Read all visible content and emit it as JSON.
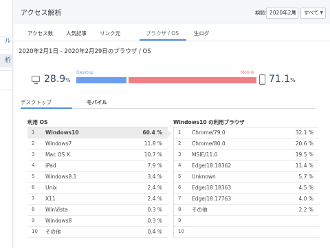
{
  "sidebar": {
    "items": [
      {
        "label": "ル"
      },
      {
        "label": "析"
      }
    ]
  },
  "header": {
    "title": "アクセス解析",
    "period_label": "期間：",
    "period_value": "2020年2月",
    "scope_value": "すべて"
  },
  "tabs": [
    {
      "label": "アクセス数"
    },
    {
      "label": "人気記事"
    },
    {
      "label": "リンク元"
    },
    {
      "label": "ブラウザ / OS"
    },
    {
      "label": "生ログ"
    }
  ],
  "date_range": "2020年2月1日 - 2020年2月29日のブラウザ / OS",
  "device_ratio": {
    "desktop_label": "Desktop",
    "mobile_label": "Mobile",
    "desktop_pct": "28.9",
    "mobile_pct": "71.1",
    "desktop_fraction": 0.289,
    "pct_unit": "%",
    "desktop_color": "#6b9ef0",
    "mobile_color": "#f07e84"
  },
  "subtabs": [
    {
      "label": "デスクトップ"
    },
    {
      "label": "モバイル"
    }
  ],
  "os_panel": {
    "title": "利用 OS",
    "rows": [
      {
        "num": "1",
        "name": "Windows10",
        "val": "60.4 %"
      },
      {
        "num": "2",
        "name": "Windows7",
        "val": "11.8 %"
      },
      {
        "num": "3",
        "name": "Mac OS X",
        "val": "10.7 %"
      },
      {
        "num": "4",
        "name": "iPad",
        "val": "7.9 %"
      },
      {
        "num": "5",
        "name": "Windows8.1",
        "val": "3.4 %"
      },
      {
        "num": "6",
        "name": "Unix",
        "val": "2.4 %"
      },
      {
        "num": "7",
        "name": "X11",
        "val": "2.4 %"
      },
      {
        "num": "8",
        "name": "WinVista",
        "val": "0.3 %"
      },
      {
        "num": "9",
        "name": "Windows8",
        "val": "0.3 %"
      },
      {
        "num": "10",
        "name": "その他",
        "val": "0.4 %"
      }
    ]
  },
  "browser_panel": {
    "title": "Windows10 の利用ブラウザ",
    "rows": [
      {
        "num": "1",
        "name": "Chrome/79.0",
        "val": "32.1 %"
      },
      {
        "num": "2",
        "name": "Chrome/80.0",
        "val": "20.6 %"
      },
      {
        "num": "3",
        "name": "MSIE/11.0",
        "val": "19.5 %"
      },
      {
        "num": "4",
        "name": "Edge/18.18362",
        "val": "11.4 %"
      },
      {
        "num": "5",
        "name": "Unknown",
        "val": "5.7 %"
      },
      {
        "num": "6",
        "name": "Edge/18.18363",
        "val": "4.5 %"
      },
      {
        "num": "7",
        "name": "Edge/18.17763",
        "val": "4.0 %"
      },
      {
        "num": "8",
        "name": "その他",
        "val": "2.2 %"
      },
      {
        "num": "9",
        "name": "",
        "val": ""
      },
      {
        "num": "10",
        "name": "",
        "val": ""
      }
    ]
  }
}
